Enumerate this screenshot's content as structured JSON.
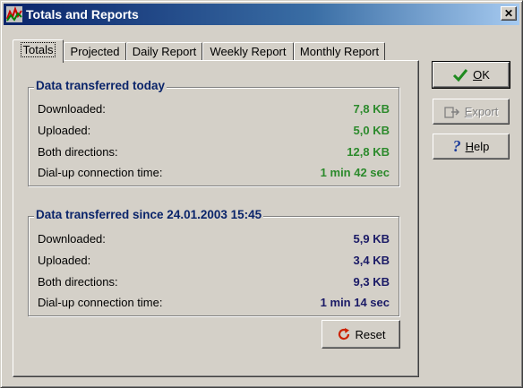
{
  "window": {
    "title": "Totals and Reports",
    "close_glyph": "✕"
  },
  "tabs": [
    {
      "label": "Totals",
      "active": true
    },
    {
      "label": "Projected",
      "active": false
    },
    {
      "label": "Daily Report",
      "active": false
    },
    {
      "label": "Weekly Report",
      "active": false
    },
    {
      "label": "Monthly Report",
      "active": false
    }
  ],
  "today": {
    "title": "Data transferred today",
    "rows": [
      {
        "label": "Downloaded:",
        "value": "7,8 KB"
      },
      {
        "label": "Uploaded:",
        "value": "5,0 KB"
      },
      {
        "label": "Both directions:",
        "value": "12,8 KB"
      },
      {
        "label": "Dial-up connection time:",
        "value": "1 min 42 sec"
      }
    ]
  },
  "since": {
    "title": "Data transferred since 24.01.2003 15:45",
    "rows": [
      {
        "label": "Downloaded:",
        "value": "5,9 KB"
      },
      {
        "label": "Uploaded:",
        "value": "3,4 KB"
      },
      {
        "label": "Both directions:",
        "value": "9,3 KB"
      },
      {
        "label": "Dial-up connection time:",
        "value": "1 min 14 sec"
      }
    ]
  },
  "buttons": {
    "ok": {
      "pre": "",
      "accel": "O",
      "post": "K",
      "icon": "checkmark-icon"
    },
    "export": {
      "pre": "",
      "accel": "E",
      "post": "xport",
      "icon": "export-icon",
      "disabled": true
    },
    "help": {
      "pre": "",
      "accel": "H",
      "post": "elp",
      "icon": "help-icon"
    },
    "reset": {
      "label": "Reset",
      "icon": "reset-icon"
    }
  },
  "colors": {
    "today_values": "#2c8a2c",
    "since_values": "#1a1a66",
    "group_title": "#0a246a",
    "title_bar": "#0a246a"
  }
}
